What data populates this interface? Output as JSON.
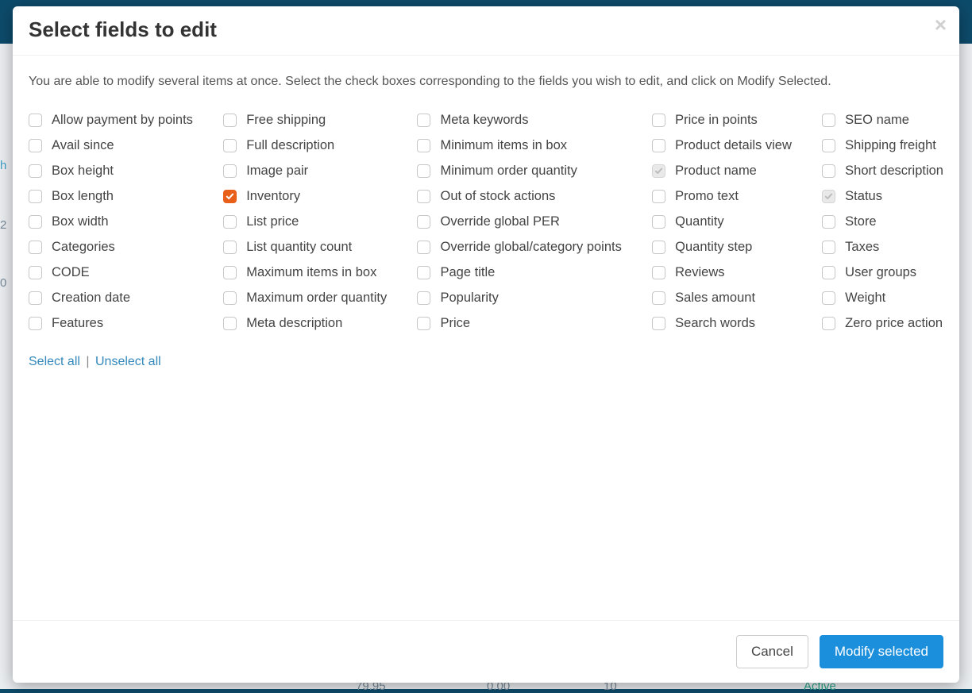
{
  "modal": {
    "title": "Select fields to edit",
    "intro": "You are able to modify several items at once. Select the check boxes corresponding to the fields you wish to edit, and click on Modify Selected.",
    "close_label": "×",
    "select_all": "Select all",
    "unselect_all": "Unselect all",
    "separator": "|",
    "cancel": "Cancel",
    "submit": "Modify selected"
  },
  "columns": [
    [
      {
        "label": "Allow payment by points",
        "checked": false,
        "disabled": false
      },
      {
        "label": "Avail since",
        "checked": false,
        "disabled": false
      },
      {
        "label": "Box height",
        "checked": false,
        "disabled": false
      },
      {
        "label": "Box length",
        "checked": false,
        "disabled": false
      },
      {
        "label": "Box width",
        "checked": false,
        "disabled": false
      },
      {
        "label": "Categories",
        "checked": false,
        "disabled": false
      },
      {
        "label": "CODE",
        "checked": false,
        "disabled": false
      },
      {
        "label": "Creation date",
        "checked": false,
        "disabled": false
      },
      {
        "label": "Features",
        "checked": false,
        "disabled": false
      }
    ],
    [
      {
        "label": "Free shipping",
        "checked": false,
        "disabled": false
      },
      {
        "label": "Full description",
        "checked": false,
        "disabled": false
      },
      {
        "label": "Image pair",
        "checked": false,
        "disabled": false
      },
      {
        "label": "Inventory",
        "checked": true,
        "disabled": false
      },
      {
        "label": "List price",
        "checked": false,
        "disabled": false
      },
      {
        "label": "List quantity count",
        "checked": false,
        "disabled": false
      },
      {
        "label": "Maximum items in box",
        "checked": false,
        "disabled": false
      },
      {
        "label": "Maximum order quantity",
        "checked": false,
        "disabled": false
      },
      {
        "label": "Meta description",
        "checked": false,
        "disabled": false
      }
    ],
    [
      {
        "label": "Meta keywords",
        "checked": false,
        "disabled": false
      },
      {
        "label": "Minimum items in box",
        "checked": false,
        "disabled": false
      },
      {
        "label": "Minimum order quantity",
        "checked": false,
        "disabled": false
      },
      {
        "label": "Out of stock actions",
        "checked": false,
        "disabled": false
      },
      {
        "label": "Override global PER",
        "checked": false,
        "disabled": false
      },
      {
        "label": "Override global/category points",
        "checked": false,
        "disabled": false
      },
      {
        "label": "Page title",
        "checked": false,
        "disabled": false
      },
      {
        "label": "Popularity",
        "checked": false,
        "disabled": false
      },
      {
        "label": "Price",
        "checked": false,
        "disabled": false
      }
    ],
    [
      {
        "label": "Price in points",
        "checked": false,
        "disabled": false
      },
      {
        "label": "Product details view",
        "checked": false,
        "disabled": false
      },
      {
        "label": "Product name",
        "checked": true,
        "disabled": true
      },
      {
        "label": "Promo text",
        "checked": false,
        "disabled": false
      },
      {
        "label": "Quantity",
        "checked": false,
        "disabled": false
      },
      {
        "label": "Quantity step",
        "checked": false,
        "disabled": false
      },
      {
        "label": "Reviews",
        "checked": false,
        "disabled": false
      },
      {
        "label": "Sales amount",
        "checked": false,
        "disabled": false
      },
      {
        "label": "Search words",
        "checked": false,
        "disabled": false
      }
    ],
    [
      {
        "label": "SEO name",
        "checked": false,
        "disabled": false
      },
      {
        "label": "Shipping freight",
        "checked": false,
        "disabled": false
      },
      {
        "label": "Short description",
        "checked": false,
        "disabled": false
      },
      {
        "label": "Status",
        "checked": true,
        "disabled": true
      },
      {
        "label": "Store",
        "checked": false,
        "disabled": false
      },
      {
        "label": "Taxes",
        "checked": false,
        "disabled": false
      },
      {
        "label": "User groups",
        "checked": false,
        "disabled": false
      },
      {
        "label": "Weight",
        "checked": false,
        "disabled": false
      },
      {
        "label": "Zero price action",
        "checked": false,
        "disabled": false
      }
    ]
  ],
  "background": {
    "price": "79.95",
    "zero": "0.00",
    "ten": "10",
    "status": "Active"
  }
}
